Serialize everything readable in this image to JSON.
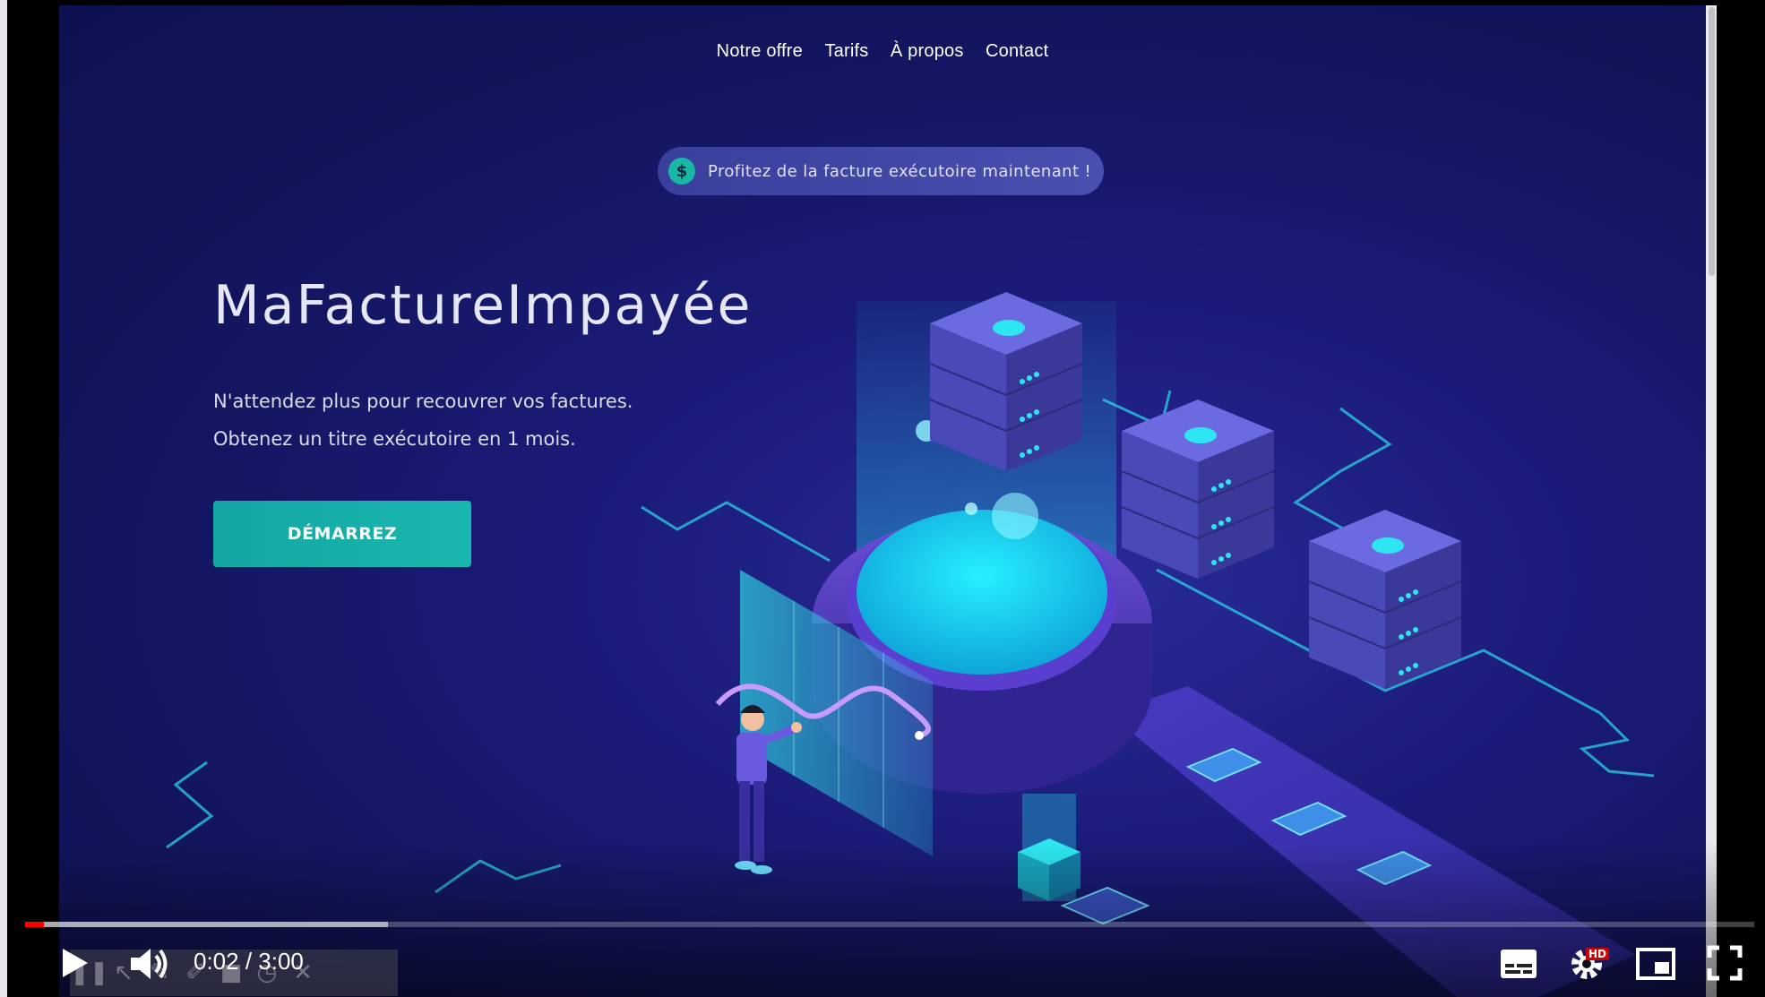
{
  "nav": [
    "Notre offre",
    "Tarifs",
    "À propos",
    "Contact"
  ],
  "promo": {
    "icon": "dollar-icon",
    "symbol": "$",
    "text": "Profitez de la facture exécutoire maintenant !"
  },
  "hero": {
    "title": "MaFactureImpayée",
    "line1": "N'attendez plus pour recouvrer vos factures.",
    "line2": "Obtenez un titre exécutoire en 1 mois.",
    "cta": "DÉMARREZ"
  },
  "player": {
    "time": "0:02 / 3:00",
    "played_fraction": 0.011,
    "loaded_fraction": 0.21,
    "hd_badge": "HD",
    "icons": [
      "play-icon",
      "volume-icon",
      "subtitles-icon",
      "settings-icon",
      "miniplayer-icon",
      "fullscreen-icon"
    ]
  },
  "colors": {
    "bg": "#12155c",
    "accent": "#18b7ad",
    "progress": "#ff0000"
  }
}
